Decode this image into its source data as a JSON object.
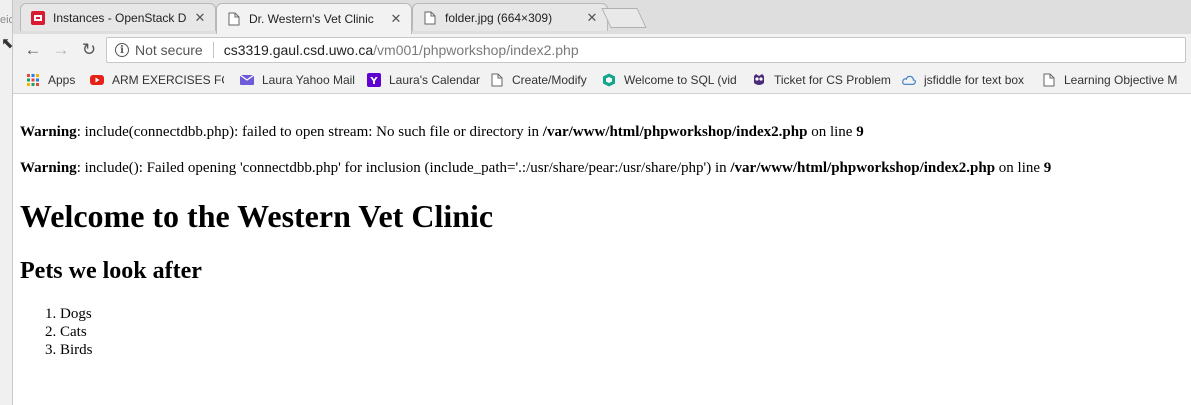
{
  "window": {
    "edge_fragment": "eic"
  },
  "tabs": [
    {
      "title": "Instances - OpenStack Da",
      "favicon": "openstack-icon",
      "active": false
    },
    {
      "title": "Dr. Western's Vet Clinic",
      "favicon": "document-icon",
      "active": true
    },
    {
      "title": "folder.jpg (664×309)",
      "favicon": "document-icon",
      "active": false
    }
  ],
  "toolbar": {
    "security_label": "Not secure",
    "url_host": "cs3319.gaul.csd.uwo.ca",
    "url_path": "/vm001/phpworkshop/index2.php"
  },
  "bookmarks": [
    {
      "label": "Apps",
      "icon": "apps-grid-icon"
    },
    {
      "label": "ARM EXERCISES FOR",
      "icon": "youtube-icon"
    },
    {
      "label": "Laura Yahoo Mail",
      "icon": "mail-icon"
    },
    {
      "label": "Laura's Calendar",
      "icon": "yahoo-icon"
    },
    {
      "label": "Create/Modify",
      "icon": "document-icon"
    },
    {
      "label": "Welcome to SQL (vid",
      "icon": "cube-icon"
    },
    {
      "label": "Ticket for CS Problem",
      "icon": "owl-icon"
    },
    {
      "label": "jsfiddle for text box",
      "icon": "cloud-icon"
    },
    {
      "label": "Learning Objective M",
      "icon": "document-icon"
    }
  ],
  "page": {
    "warnings": [
      {
        "label": "Warning",
        "message": ": include(connectdbb.php): failed to open stream: No such file or directory in ",
        "file": "/var/www/html/phpworkshop/index2.php",
        "line_prefix": " on line ",
        "line": "9"
      },
      {
        "label": "Warning",
        "message": ": include(): Failed opening 'connectdbb.php' for inclusion (include_path='.:/usr/share/pear:/usr/share/php') in ",
        "file": "/var/www/html/phpworkshop/index2.php",
        "line_prefix": " on line ",
        "line": "9"
      }
    ],
    "heading": "Welcome to the Western Vet Clinic",
    "subheading": "Pets we look after",
    "pets": [
      "Dogs",
      "Cats",
      "Birds"
    ]
  },
  "colors": {
    "tab_strip": "#dedede",
    "toolbar": "#f2f2f2",
    "openstack_red": "#da1a32",
    "youtube_red": "#e62117",
    "yahoo_purple": "#5f01d1",
    "sql_teal": "#15a589"
  }
}
